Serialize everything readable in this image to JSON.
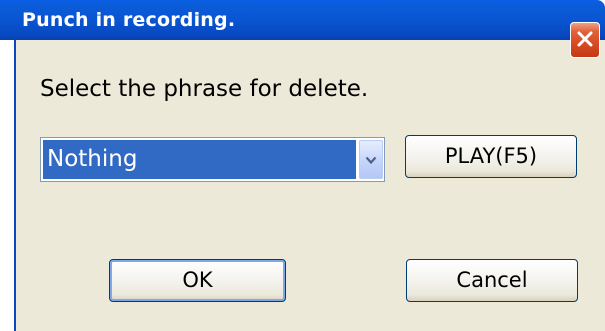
{
  "window": {
    "title": "Punch in recording."
  },
  "dialog": {
    "prompt": "Select the phrase for delete.",
    "phrase_select": {
      "selected_value": "Nothing"
    },
    "buttons": {
      "play": "PLAY(F5)",
      "ok": "OK",
      "cancel": "Cancel"
    }
  },
  "icons": {
    "close": "close-icon",
    "dropdown": "chevron-down-icon"
  },
  "colors": {
    "titlebar": "#0a55d2",
    "close_button": "#d4451e",
    "dialog_background": "#ece9d8",
    "selection_highlight": "#316ac5"
  }
}
